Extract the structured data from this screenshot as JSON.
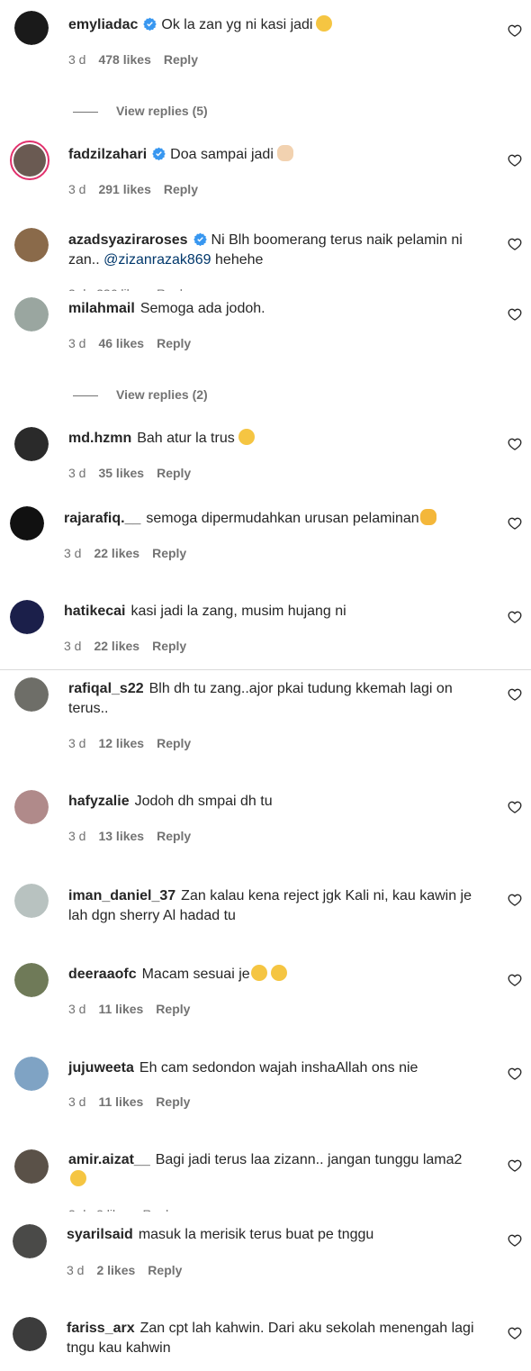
{
  "comments": [
    {
      "user": "emyliadac",
      "verified": true,
      "text": "Ok la zan yg ni kasi jadi",
      "emoji": "zany-face",
      "time": "3 d",
      "likes": "478 likes",
      "reply": "Reply",
      "avatar_color": "#1a1a1a"
    },
    {
      "user": "fadzilzahari",
      "verified": true,
      "text": "Doa sampai jadi",
      "emoji": "praying-hands",
      "time": "3 d",
      "likes": "291 likes",
      "reply": "Reply",
      "avatar_color": "#6a5a52"
    },
    {
      "user": "azadsyaziraroses",
      "verified": true,
      "text": "Ni Blh boomerang terus naik pelamin ni zan..",
      "mention": "@zizanrazak869",
      "text_after": "hehehe",
      "avatar_color": "#8a6a4a"
    },
    {
      "user": "milahmail",
      "verified": false,
      "text": "Semoga ada jodoh.",
      "time": "3 d",
      "likes": "46 likes",
      "reply": "Reply",
      "avatar_color": "#9aa6a0"
    },
    {
      "user": "md.hzmn",
      "verified": false,
      "text": "Bah atur la trus",
      "emoji": "laughing-face",
      "time": "3 d",
      "likes": "35 likes",
      "reply": "Reply",
      "avatar_color": "#2a2a2a"
    },
    {
      "user": "rajarafiq.__",
      "verified": false,
      "text": "semoga dipermudahkan urusan pelaminan",
      "emoji": "clapping-hands",
      "time": "3 d",
      "likes": "22 likes",
      "reply": "Reply",
      "avatar_color": "#111111"
    },
    {
      "user": "hatikecai",
      "verified": false,
      "text": "kasi jadi la zang, musim hujang ni",
      "time": "3 d",
      "likes": "22 likes",
      "reply": "Reply",
      "avatar_color": "#1b1f4a"
    },
    {
      "user": "rafiqal_s22",
      "verified": false,
      "text": "Blh dh tu zang..ajor pkai tudung kkemah lagi on terus..",
      "time": "3 d",
      "likes": "12 likes",
      "reply": "Reply",
      "avatar_color": "#6e6e68"
    },
    {
      "user": "hafyzalie",
      "verified": false,
      "text": "Jodoh dh smpai dh tu",
      "time": "3 d",
      "likes": "13 likes",
      "reply": "Reply",
      "avatar_color": "#b08a8a"
    },
    {
      "user": "iman_daniel_37",
      "verified": false,
      "text": "Zan kalau kena reject jgk Kali ni, kau kawin je lah dgn sherry Al hadad tu",
      "avatar_color": "#b8c2c0"
    },
    {
      "user": "deeraaofc",
      "verified": false,
      "text": "Macam sesuai je",
      "emoji": "smiling-faces",
      "time": "3 d",
      "likes": "11 likes",
      "reply": "Reply",
      "avatar_color": "#6f7a58"
    },
    {
      "user": "jujuweeta",
      "verified": false,
      "text": "Eh cam sedondon wajah inshaAllah ons nie",
      "time": "3 d",
      "likes": "11 likes",
      "reply": "Reply",
      "avatar_color": "#7fa3c4"
    },
    {
      "user": "amir.aizat__",
      "verified": false,
      "text": "Bagi jadi terus laa zizann.. jangan tunggu lama2",
      "emoji": "squinting-tongue-face",
      "avatar_color": "#5a5148"
    },
    {
      "user": "syarilsaid",
      "verified": false,
      "text": "masuk la merisik terus buat pe tnggu",
      "time": "3 d",
      "likes": "2 likes",
      "reply": "Reply",
      "avatar_color": "#4a4a48"
    },
    {
      "user": "fariss_arx",
      "verified": false,
      "text": "Zan cpt lah kahwin. Dari aku sekolah menengah lagi tngu kau kahwin",
      "avatar_color": "#3c3c3c"
    }
  ],
  "view_replies": [
    "View replies (5)",
    "View replies (2)"
  ],
  "colors": {
    "verified": "#3897f0",
    "muted": "#737373",
    "text": "#262626",
    "link": "#00376b"
  }
}
